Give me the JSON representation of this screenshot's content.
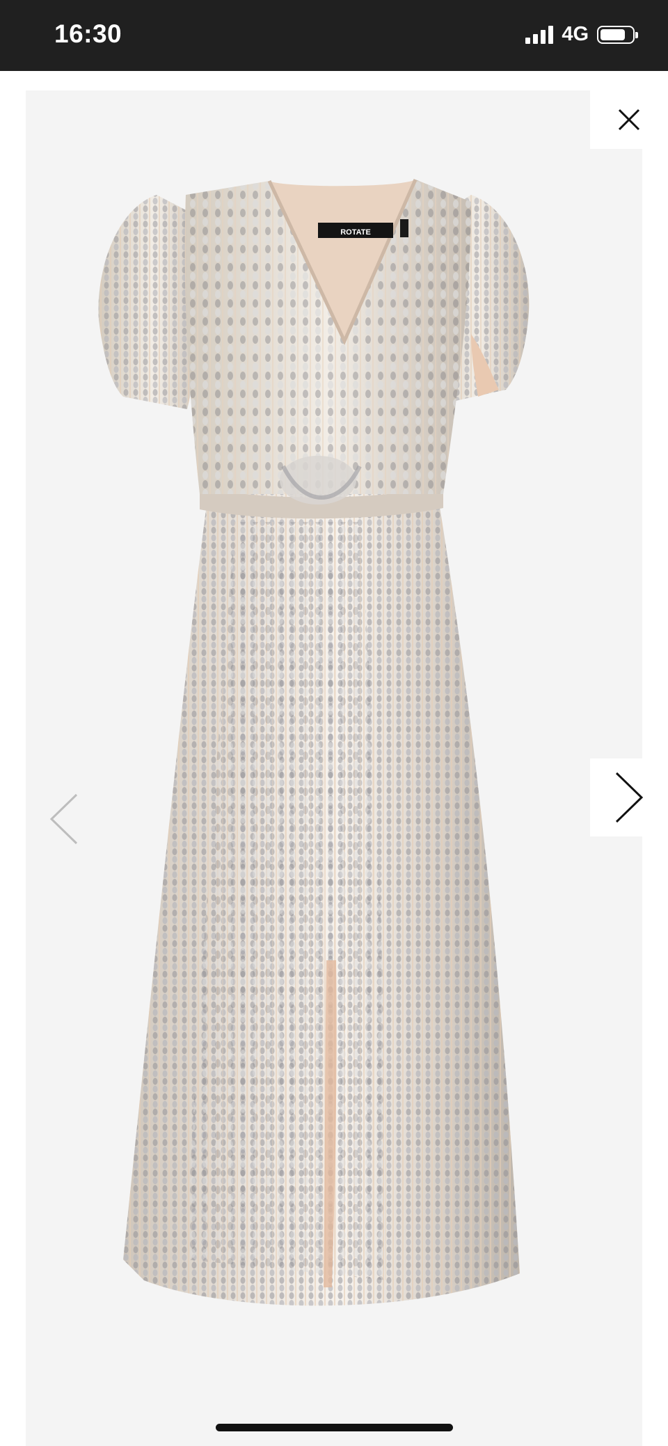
{
  "status_bar": {
    "time": "16:30",
    "network": "4G",
    "signal_bars": 4,
    "battery_level": 0.8
  },
  "product_image": {
    "brand_label": "ROTATE",
    "colors": {
      "backdrop": "#f4f4f4",
      "lining": "#e9d3c1",
      "sequin_silver": "#c9c9c9",
      "sequin_gold": "#d8c3a4"
    }
  },
  "controls": {
    "close_icon": "close-icon",
    "prev_icon": "chevron-left-icon",
    "next_icon": "chevron-right-icon"
  }
}
